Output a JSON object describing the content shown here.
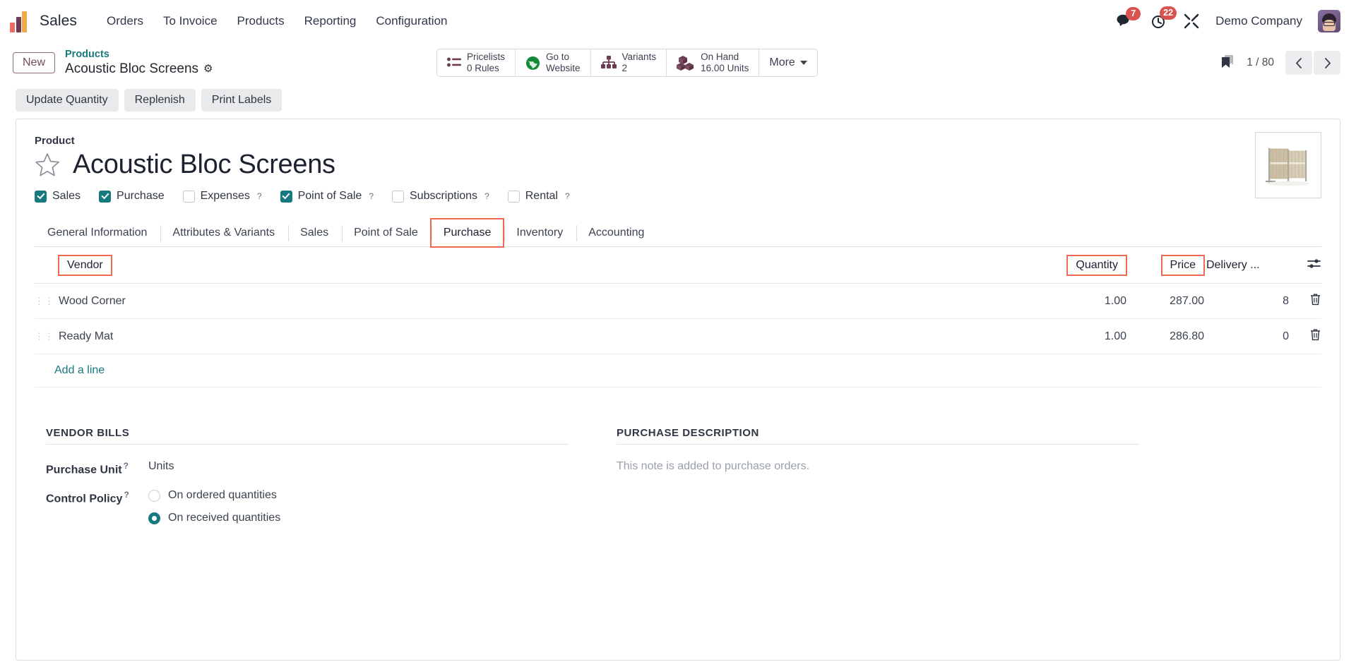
{
  "navbar": {
    "app_name": "Sales",
    "menus": [
      "Orders",
      "To Invoice",
      "Products",
      "Reporting",
      "Configuration"
    ],
    "messages_badge": "7",
    "activities_badge": "22",
    "company": "Demo Company",
    "icons": {
      "messages": "chat-bubbles-icon",
      "activities": "clock-icon",
      "debug": "tools-icon",
      "avatar": "user-avatar"
    }
  },
  "control_panel": {
    "new_button": "New",
    "breadcrumb_parent": "Products",
    "breadcrumb_current": "Acoustic Bloc Screens",
    "stat_buttons": [
      {
        "label": "Pricelists",
        "value": "0 Rules",
        "icon": "list-icon"
      },
      {
        "label": "Go to",
        "value": "Website",
        "icon": "globe-icon"
      },
      {
        "label": "Variants",
        "value": "2",
        "icon": "hierarchy-icon"
      },
      {
        "label": "On Hand",
        "value": "16.00 Units",
        "icon": "boxes-icon"
      }
    ],
    "more_label": "More",
    "pager": "1 / 80"
  },
  "action_buttons": [
    "Update Quantity",
    "Replenish",
    "Print Labels"
  ],
  "form": {
    "label_product": "Product",
    "title": "Acoustic Bloc Screens",
    "checkboxes": [
      {
        "label": "Sales",
        "checked": true,
        "help": false
      },
      {
        "label": "Purchase",
        "checked": true,
        "help": false
      },
      {
        "label": "Expenses",
        "checked": false,
        "help": true
      },
      {
        "label": "Point of Sale",
        "checked": true,
        "help": true
      },
      {
        "label": "Subscriptions",
        "checked": false,
        "help": true
      },
      {
        "label": "Rental",
        "checked": false,
        "help": true
      }
    ],
    "tabs": [
      {
        "label": "General Information",
        "active": false
      },
      {
        "label": "Attributes & Variants",
        "active": false
      },
      {
        "label": "Sales",
        "active": false
      },
      {
        "label": "Point of Sale",
        "active": false
      },
      {
        "label": "Purchase",
        "active": true,
        "annotated": true
      },
      {
        "label": "Inventory",
        "active": false
      },
      {
        "label": "Accounting",
        "active": false
      }
    ],
    "vendor_table": {
      "columns": [
        {
          "label": "Vendor",
          "annotated": true
        },
        {
          "label": "Quantity",
          "annotated": true
        },
        {
          "label": "Price",
          "annotated": true
        },
        {
          "label": "Delivery ...",
          "annotated": false
        }
      ],
      "rows": [
        {
          "vendor": "Wood Corner",
          "quantity": "1.00",
          "price": "287.00",
          "delivery": "8"
        },
        {
          "vendor": "Ready Mat",
          "quantity": "1.00",
          "price": "286.80",
          "delivery": "0"
        }
      ],
      "add_line": "Add a line"
    },
    "vendor_bills": {
      "title": "VENDOR BILLS",
      "purchase_unit_label": "Purchase Unit",
      "purchase_unit_value": "Units",
      "control_policy_label": "Control Policy",
      "control_policy_options": [
        {
          "label": "On ordered quantities",
          "selected": false
        },
        {
          "label": "On received quantities",
          "selected": true
        }
      ]
    },
    "purchase_description": {
      "title": "PURCHASE DESCRIPTION",
      "placeholder": "This note is added to purchase orders."
    }
  },
  "colors": {
    "accent": "#17787f",
    "annotation": "#ed6a50",
    "badge": "#d9534f",
    "link": "#17787f"
  }
}
